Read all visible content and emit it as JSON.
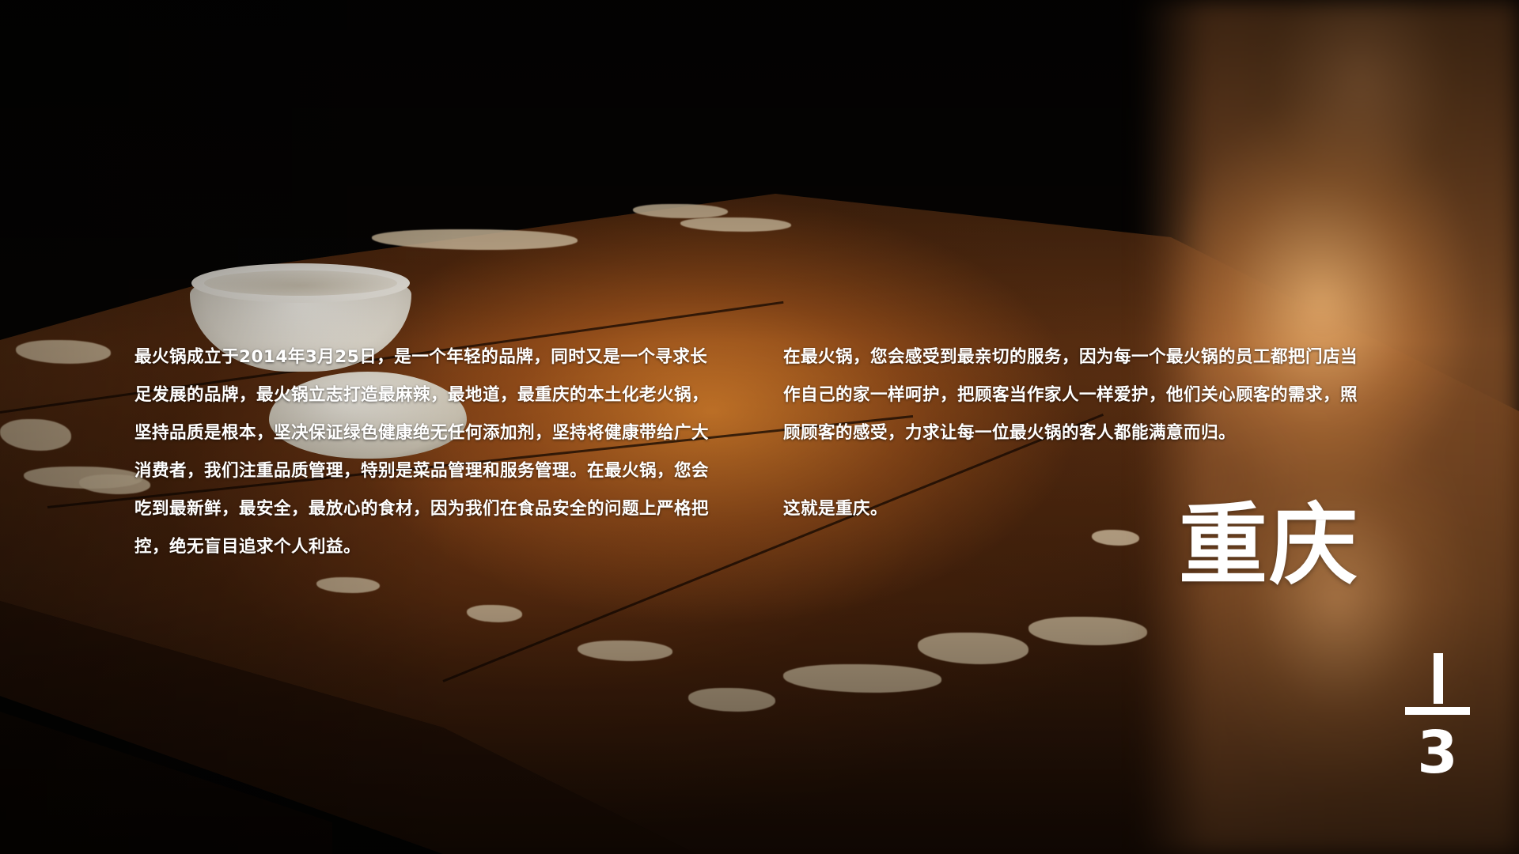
{
  "background": {
    "description_icon": "wooden-table-with-teacup-photo-icon",
    "dark_color": "#050302",
    "wood_color": "#8a4a1c",
    "highlight_color": "#e6a35a"
  },
  "content": {
    "left_paragraph": "最火锅成立于2014年3月25日，是一个年轻的品牌，同时又是一个寻求长足发展的品牌，最火锅立志打造最麻辣，最地道，最重庆的本土化老火锅，坚持品质是根本，坚决保证绿色健康绝无任何添加剂，坚持将健康带给广大消费者，我们注重品质管理，特别是菜品管理和服务管理。在最火锅，您会吃到最新鲜，最安全，最放心的食材，因为我们在食品安全的问题上严格把控，绝无盲目追求个人利益。",
    "right_paragraph_1": "在最火锅，您会感受到最亲切的服务，因为每一个最火锅的员工都把门店当作自己的家一样呵护，把顾客当作家人一样爱护，他们关心顾客的需求，照顾顾客的感受，力求让每一位最火锅的客人都能满意而归。",
    "right_paragraph_2": "这就是重庆。"
  },
  "title": "重庆",
  "logo": {
    "icon": "one-third-fraction-logo-icon",
    "text": "3",
    "color": "#ffffff"
  }
}
